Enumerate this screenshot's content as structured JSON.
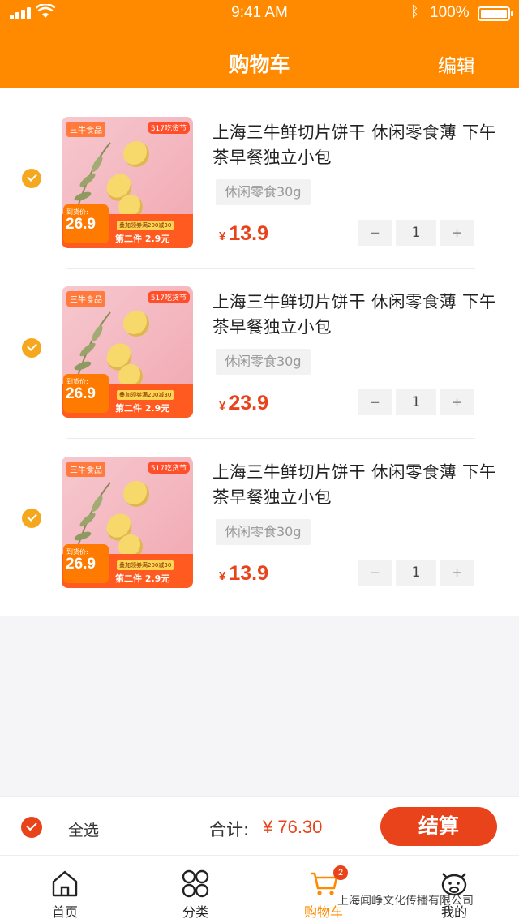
{
  "status_bar": {
    "time": "9:41 AM",
    "battery": "100%"
  },
  "header": {
    "title": "购物车",
    "edit_label": "编辑"
  },
  "items": [
    {
      "title": "上海三牛鲜切片饼干 休闲零食薄 下午茶早餐独立小包",
      "spec": "休闲零食30g",
      "currency": "¥",
      "price": "13.9",
      "quantity": "1",
      "thumb": {
        "brand": "三牛食品",
        "festival": "517吃货节",
        "price_label": "到货价:",
        "price": "26.9",
        "promo1": "叠加领券满200减30",
        "promo2": "第二件 2.9元"
      }
    },
    {
      "title": "上海三牛鲜切片饼干 休闲零食薄 下午茶早餐独立小包",
      "spec": "休闲零食30g",
      "currency": "¥",
      "price": "23.9",
      "quantity": "1",
      "thumb": {
        "brand": "三牛食品",
        "festival": "517吃货节",
        "price_label": "到货价:",
        "price": "26.9",
        "promo1": "叠加领券满200减30",
        "promo2": "第二件 2.9元"
      }
    },
    {
      "title": "上海三牛鲜切片饼干 休闲零食薄 下午茶早餐独立小包",
      "spec": "休闲零食30g",
      "currency": "¥",
      "price": "13.9",
      "quantity": "1",
      "thumb": {
        "brand": "三牛食品",
        "festival": "517吃货节",
        "price_label": "到货价:",
        "price": "26.9",
        "promo1": "叠加领券满200减30",
        "promo2": "第二件 2.9元"
      }
    }
  ],
  "stepper": {
    "minus": "−",
    "plus": "+"
  },
  "footer": {
    "select_all": "全选",
    "total_label": "合计:",
    "total_value": "¥ 76.30",
    "checkout": "结算"
  },
  "tabs": [
    {
      "label": "首页",
      "icon": "home-icon"
    },
    {
      "label": "分类",
      "icon": "category-icon"
    },
    {
      "label": "购物车",
      "icon": "cart-icon",
      "badge": "2",
      "active": true
    },
    {
      "label": "我的",
      "icon": "profile-icon"
    }
  ],
  "watermark": "上海闻峥文化传播有限公司",
  "colors": {
    "brand": "#ff8a00",
    "price": "#e8431b",
    "check": "#f5a81e"
  }
}
